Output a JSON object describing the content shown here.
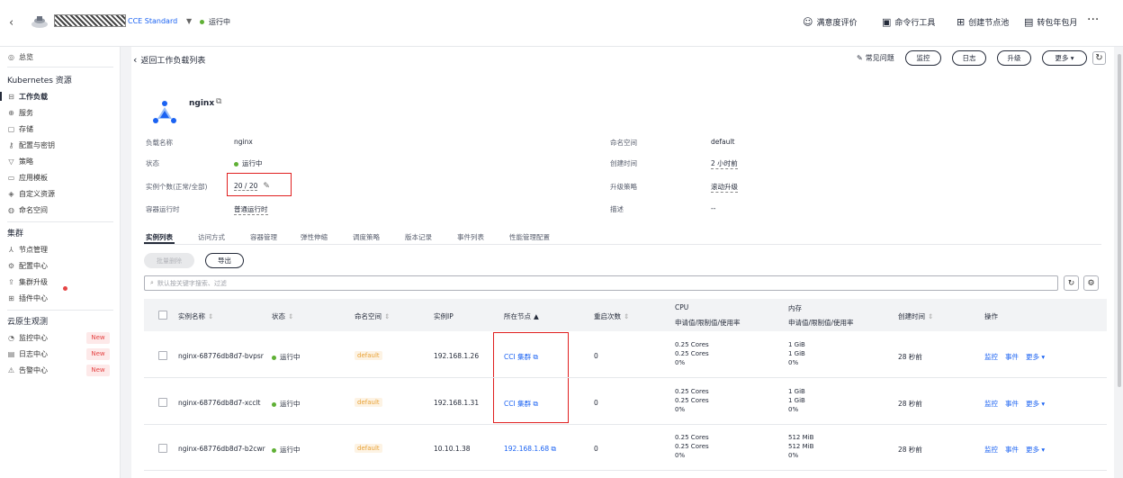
{
  "topbar": {
    "cluster_name": "CCE Standard",
    "status": "运行中",
    "right_items": [
      "满意度评价",
      "命令行工具",
      "创建节点池",
      "转包年包月"
    ],
    "more": "···"
  },
  "sidebar": {
    "overview": "总览",
    "k8s_header": "Kubernetes 资源",
    "k8s_items": [
      "工作负载",
      "服务",
      "存储",
      "配置与密钥",
      "策略",
      "应用模板",
      "自定义资源",
      "命名空间"
    ],
    "cluster_header": "集群",
    "cluster_items": [
      "节点管理",
      "配置中心",
      "集群升级",
      "插件中心"
    ],
    "obs_header": "云原生观测",
    "obs_items": [
      "监控中心",
      "日志中心",
      "告警中心"
    ],
    "new_badge": "New"
  },
  "header": {
    "back_label": "返回工作负载列表",
    "faq": "常见问题",
    "buttons": [
      "监控",
      "日志",
      "升级",
      "更多 ▾"
    ]
  },
  "workload": {
    "name": "nginx",
    "fields_left": [
      {
        "label": "负载名称",
        "value": "nginx"
      },
      {
        "label": "状态",
        "value": "运行中"
      },
      {
        "label": "实例个数(正常/全部)",
        "value": "20 / 20"
      },
      {
        "label": "容器运行时",
        "value": "普通运行时"
      }
    ],
    "fields_right": [
      {
        "label": "命名空间",
        "value": "default"
      },
      {
        "label": "创建时间",
        "value": "2 小时前"
      },
      {
        "label": "升级策略",
        "value": "滚动升级"
      },
      {
        "label": "描述",
        "value": "--"
      }
    ]
  },
  "tabs": [
    "实例列表",
    "访问方式",
    "容器管理",
    "弹性伸缩",
    "调度策略",
    "版本记录",
    "事件列表",
    "性能管理配置"
  ],
  "actions": {
    "batch_delete": "批量删除",
    "export": "导出"
  },
  "search": {
    "placeholder": "默认按关键字搜索、过滤"
  },
  "table": {
    "columns": [
      "实例名称",
      "状态",
      "命名空间",
      "实例IP",
      "所在节点",
      "重启次数",
      "CPU",
      "内存",
      "创建时间",
      "操作"
    ],
    "cpu_sub": "申请值/限制值/使用率",
    "mem_sub": "申请值/限制值/使用率",
    "rows": [
      {
        "name": "nginx-68776db8d7-bvpsr",
        "status": "运行中",
        "ns": "default",
        "ip": "192.168.1.26",
        "node": "CCI 集群",
        "restarts": "0",
        "cpu": [
          "0.25 Cores",
          "0.25 Cores",
          "0%"
        ],
        "mem": [
          "1 GiB",
          "1 GiB",
          "0%"
        ],
        "created": "28 秒前"
      },
      {
        "name": "nginx-68776db8d7-xcclt",
        "status": "运行中",
        "ns": "default",
        "ip": "192.168.1.31",
        "node": "CCI 集群",
        "restarts": "0",
        "cpu": [
          "0.25 Cores",
          "0.25 Cores",
          "0%"
        ],
        "mem": [
          "1 GiB",
          "1 GiB",
          "0%"
        ],
        "created": "28 秒前"
      },
      {
        "name": "nginx-68776db8d7-b2cwr",
        "status": "运行中",
        "ns": "default",
        "ip": "10.10.1.38",
        "node": "192.168.1.68",
        "restarts": "0",
        "cpu": [
          "0.25 Cores",
          "0.25 Cores",
          "0%"
        ],
        "mem": [
          "512 MiB",
          "512 MiB",
          "0%"
        ],
        "created": "28 秒前"
      }
    ],
    "ops": [
      "监控",
      "事件",
      "更多 ▾"
    ]
  },
  "colors": {
    "link": "#1a62f2",
    "running": "#5fb035",
    "highlight": "#e02020",
    "ns_tag": "#e8a134"
  }
}
